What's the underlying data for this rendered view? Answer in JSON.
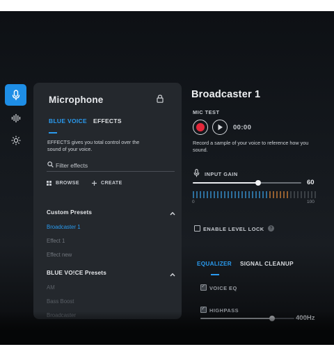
{
  "rail": {
    "items": [
      {
        "icon": "microphone-icon",
        "active": true
      },
      {
        "icon": "waveform-icon",
        "active": false
      },
      {
        "icon": "brightness-icon",
        "active": false
      }
    ]
  },
  "left_panel": {
    "title": "Microphone",
    "tabs": [
      {
        "label": "BLUE VOICE",
        "active": true
      },
      {
        "label": "EFFECTS",
        "active": false
      }
    ],
    "description": "EFFECTS gives you total control over the sound of your voice.",
    "search": {
      "placeholder": "Filter effects",
      "value": ""
    },
    "actions": {
      "browse": "BROWSE",
      "create": "CREATE"
    },
    "custom_presets": {
      "heading": "Custom Presets",
      "items": [
        "Broadcaster 1",
        "Effect 1",
        "Effect new"
      ],
      "selected": "Broadcaster 1"
    },
    "blue_voice_presets": {
      "heading": "BLUE VO!CE Presets",
      "items": [
        "AM",
        "Bass Boost",
        "Broadcaster"
      ]
    }
  },
  "right_panel": {
    "title": "Broadcaster 1",
    "mic_test": {
      "label": "MIC TEST",
      "timer": "00:00",
      "description": "Record a sample of your voice to reference how you sound."
    },
    "input_gain": {
      "label": "INPUT GAIN",
      "value": "60",
      "level": 0.6,
      "scale_min": "0",
      "scale_max": "100"
    },
    "level_lock": {
      "label": "ENABLE LEVEL LOCK",
      "checked": false,
      "help": "?"
    },
    "tabs": [
      {
        "label": "EQUALIZER",
        "active": true
      },
      {
        "label": "SIGNAL CLEANUP",
        "active": false
      }
    ],
    "voice_eq": {
      "label": "VOICE EQ",
      "checked": true
    },
    "highpass": {
      "label": "HIGHPASS",
      "checked": true,
      "value": "400Hz",
      "level": 0.76
    }
  },
  "colors": {
    "accent": "#2a9bf0",
    "record": "#e4283b",
    "panel": "#24282d",
    "meter_blue": "#3a9de0",
    "meter_orange": "#d9863a"
  }
}
